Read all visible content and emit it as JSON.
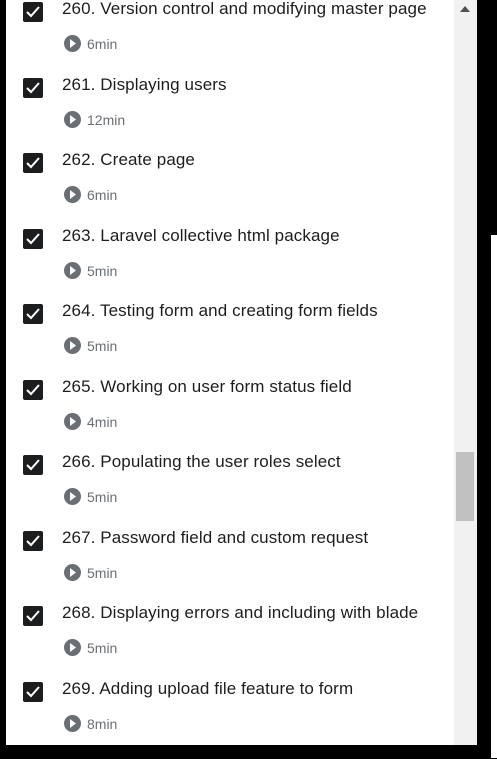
{
  "lectures": [
    {
      "title": "260. Version control and modifying master page",
      "duration": "6min"
    },
    {
      "title": "261. Displaying users",
      "duration": "12min"
    },
    {
      "title": "262. Create page",
      "duration": "6min"
    },
    {
      "title": "263. Laravel collective html package",
      "duration": "5min"
    },
    {
      "title": "264. Testing form and creating form fields",
      "duration": "5min"
    },
    {
      "title": "265. Working on user form status field",
      "duration": "4min"
    },
    {
      "title": "266. Populating the user roles select",
      "duration": "5min"
    },
    {
      "title": "267. Password field and custom request",
      "duration": "5min"
    },
    {
      "title": "268. Displaying errors and including with blade",
      "duration": "5min"
    },
    {
      "title": "269. Adding upload file feature to form",
      "duration": "8min"
    }
  ],
  "icons": {
    "checkbox": "checkbox-checked-icon",
    "play": "play-circle-icon"
  },
  "colors": {
    "text": "#1c1d1f",
    "muted": "#6a6f73",
    "checkbox_fill": "#1c1d1f"
  }
}
